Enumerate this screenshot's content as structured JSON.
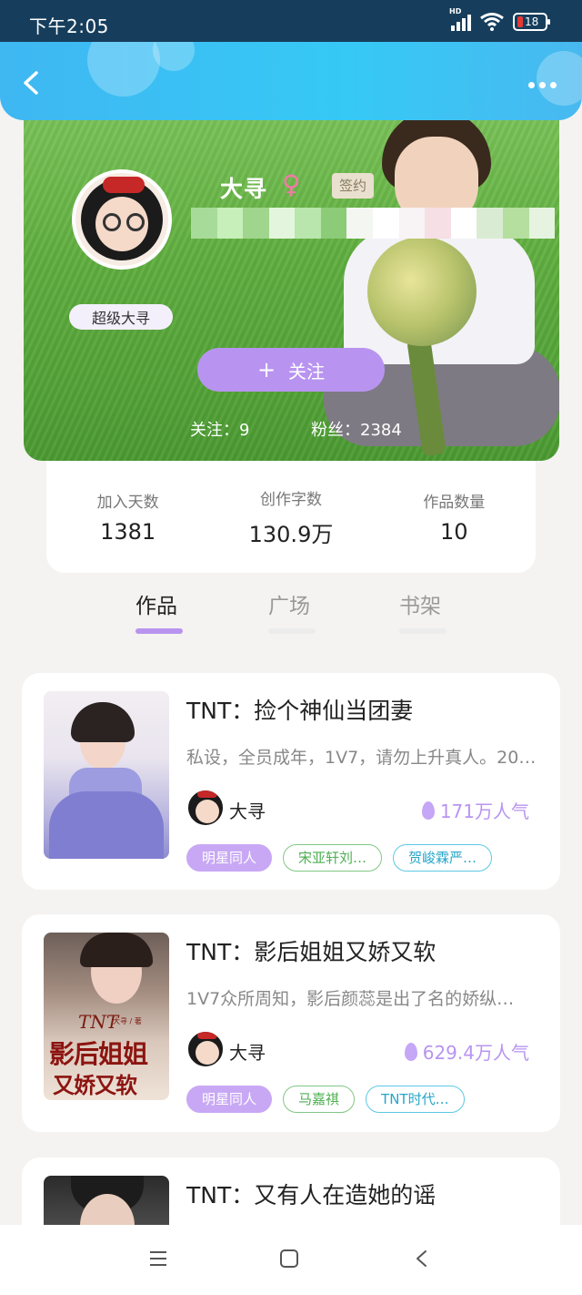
{
  "status_bar": {
    "time": "下午2:05",
    "network_label": "HD",
    "battery_level": "18"
  },
  "header": {
    "back_icon": "chevron-left-icon",
    "more_icon": "more-horizontal-icon"
  },
  "profile": {
    "name": "大寻",
    "gender_symbol": "♀",
    "signed_label": "签约",
    "badge_label": "超级大寻",
    "follow_button_plus": "+",
    "follow_button_label": "关注",
    "following_text": "关注：9",
    "fans_text": "粉丝：2384"
  },
  "stats": [
    {
      "label": "加入天数",
      "value": "1381"
    },
    {
      "label": "创作字数",
      "value": "130.9万"
    },
    {
      "label": "作品数量",
      "value": "10"
    }
  ],
  "tabs": [
    {
      "label": "作品",
      "active": true
    },
    {
      "label": "广场",
      "active": false
    },
    {
      "label": "书架",
      "active": false
    }
  ],
  "books": [
    {
      "title": "TNT：捡个神仙当团妻",
      "desc": "私设，全员成年，1V7，请勿上升真人。20…",
      "author": "大寻",
      "popularity": "171万人气",
      "tags": [
        "明星同人",
        "宋亚轩刘…",
        "贺峻霖严…"
      ]
    },
    {
      "title": "TNT：影后姐姐又娇又软",
      "desc": "1V7众所周知，影后颜蕊是出了名的娇纵…",
      "author": "大寻",
      "popularity": "629.4万人气",
      "cover_text_top": "TNT",
      "cover_text_sub": "大寻 / 著",
      "cover_text_line1": "影后姐姐",
      "cover_text_line2": "又娇又软",
      "tags": [
        "明星同人",
        "马嘉祺",
        "TNT时代…"
      ]
    },
    {
      "title": "TNT：又有人在造她的谣"
    }
  ],
  "colors": {
    "accent": "#b894f0",
    "header": "#3fb7f2",
    "status_bar": "#163e5c"
  }
}
